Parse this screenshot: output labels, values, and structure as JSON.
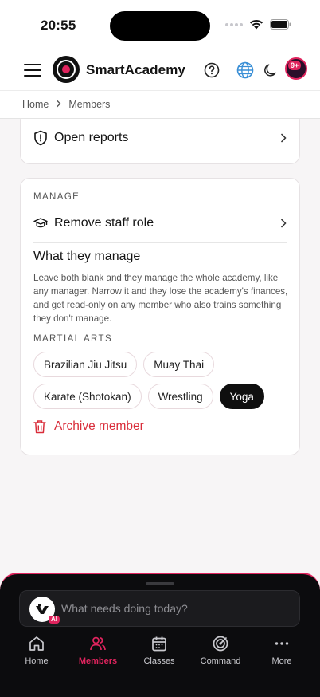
{
  "status": {
    "time": "20:55"
  },
  "header": {
    "app_title": "SmartAcademy",
    "notifications_badge": "9+"
  },
  "breadcrumb": {
    "home": "Home",
    "current": "Members"
  },
  "reports": {
    "label": "Open reports"
  },
  "manage": {
    "kicker": "MANAGE",
    "remove_label": "Remove staff role",
    "title": "What they manage",
    "description": "Leave both blank and they manage the whole academy, like any manager. Narrow it and they lose the academy's finances, and get read-only on any member who also trains something they don't manage.",
    "martial_arts_label": "MARTIAL ARTS",
    "chips": [
      {
        "label": "Brazilian Jiu Jitsu",
        "selected": false
      },
      {
        "label": "Muay Thai",
        "selected": false
      },
      {
        "label": "Karate (Shotokan)",
        "selected": false
      },
      {
        "label": "Wrestling",
        "selected": false
      },
      {
        "label": "Yoga",
        "selected": true
      }
    ],
    "archive_label": "Archive member"
  },
  "assistant": {
    "placeholder": "What needs doing today?",
    "ai_tag": "AI"
  },
  "nav": {
    "items": [
      {
        "label": "Home",
        "icon": "home-icon"
      },
      {
        "label": "Members",
        "icon": "members-icon",
        "active": true
      },
      {
        "label": "Classes",
        "icon": "calendar-icon"
      },
      {
        "label": "Command",
        "icon": "target-icon"
      },
      {
        "label": "More",
        "icon": "more-icon"
      }
    ]
  },
  "colors": {
    "accent": "#e0245e",
    "danger": "#d92d3a",
    "sheet": "#0c0c0e"
  }
}
